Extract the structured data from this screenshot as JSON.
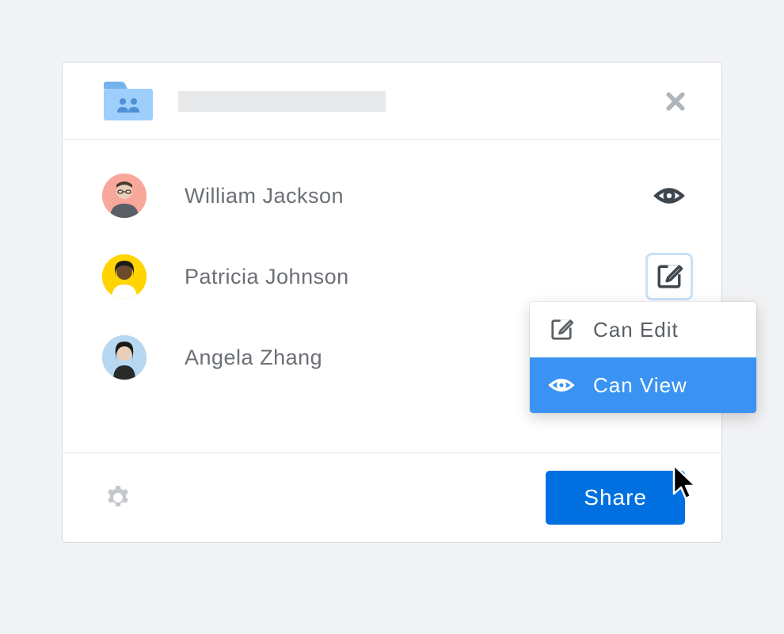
{
  "header": {
    "folder_icon": "shared-folder-icon",
    "close_label": "Close"
  },
  "users": [
    {
      "name": "William Jackson",
      "permission": "view",
      "avatar_color": "#f8a89b"
    },
    {
      "name": "Patricia Johnson",
      "permission": "edit",
      "avatar_color": "#ffd400",
      "active": true
    },
    {
      "name": "Angela Zhang",
      "permission": "view",
      "avatar_color": "#b7d8f0"
    }
  ],
  "permissions_menu": {
    "options": [
      {
        "icon": "edit-icon",
        "label": "Can Edit",
        "selected": false
      },
      {
        "icon": "eye-icon",
        "label": "Can View",
        "selected": true
      }
    ]
  },
  "footer": {
    "settings_label": "Settings",
    "share_button": "Share"
  },
  "colors": {
    "primary": "#0070e0",
    "accent_blue": "#3a93f2",
    "folder_blue_light": "#9ecefb",
    "folder_blue_dark": "#4d90d6"
  }
}
